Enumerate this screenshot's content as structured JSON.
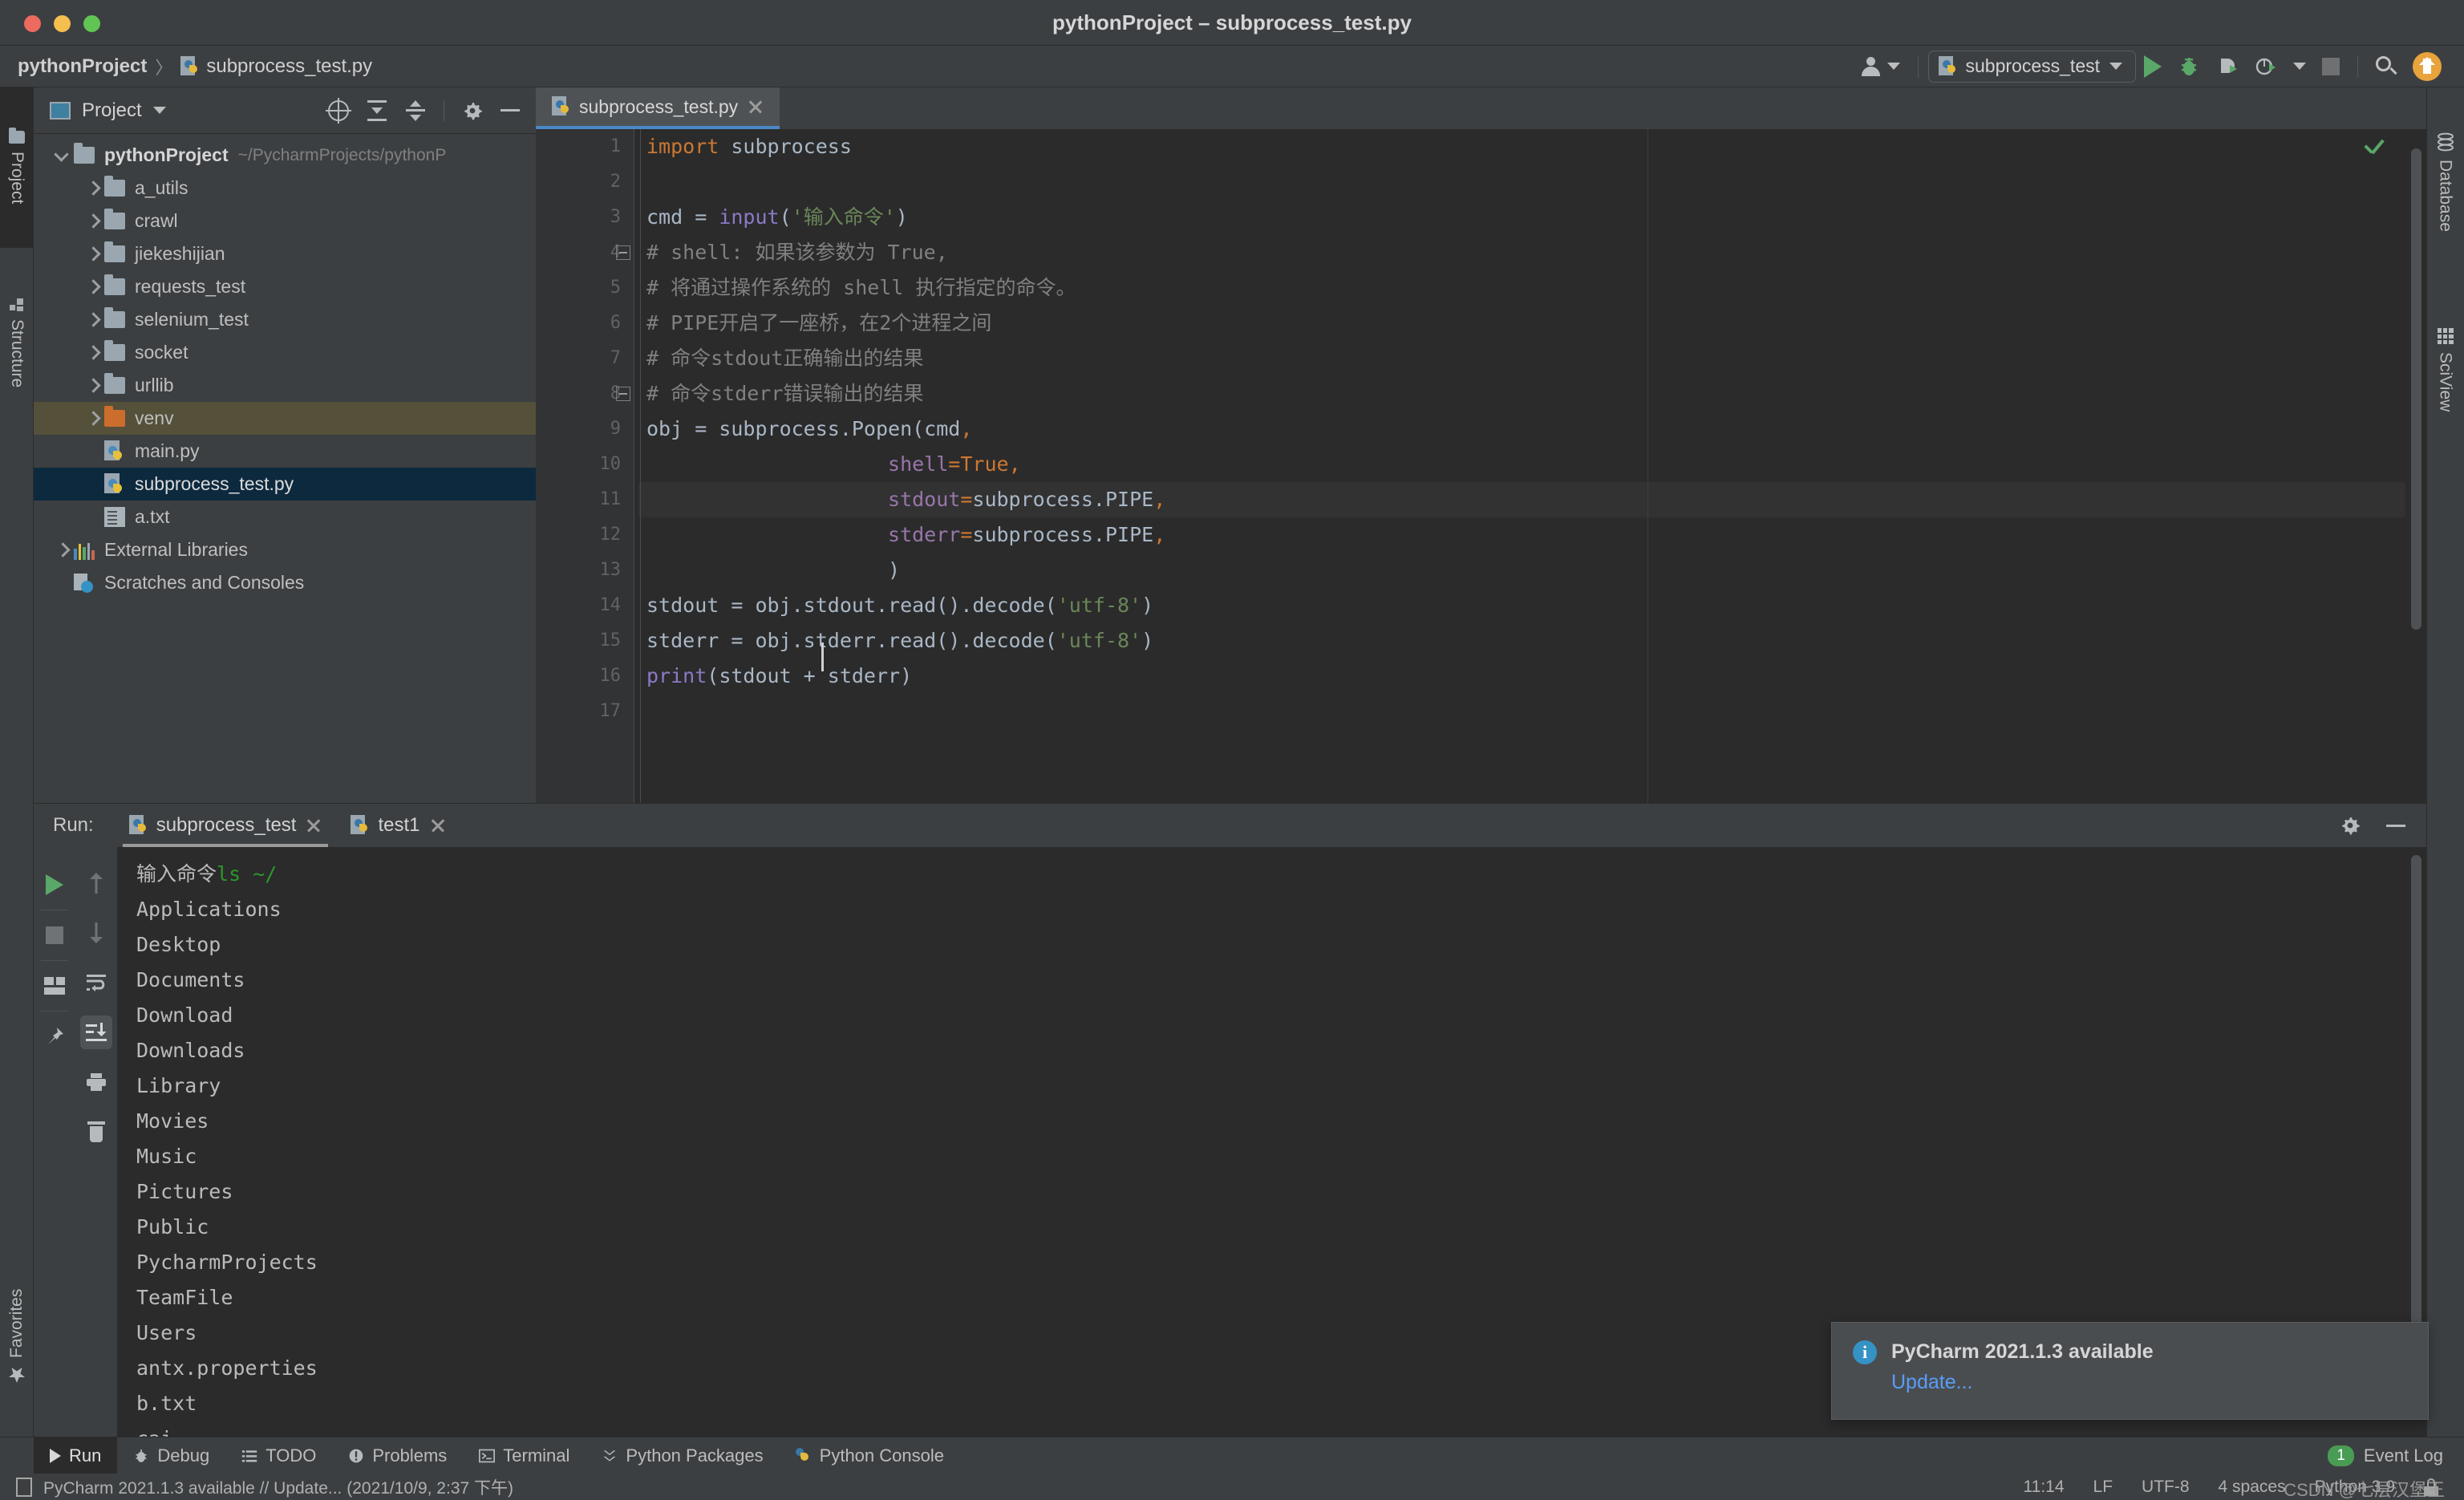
{
  "window": {
    "title": "pythonProject – subprocess_test.py",
    "traffic_lights": [
      "close-red",
      "minimize-yellow",
      "maximize-green"
    ]
  },
  "navbar": {
    "breadcrumb": {
      "project": "pythonProject",
      "separator": "〉",
      "file": "subprocess_test.py",
      "file_icon": "python-file-icon"
    },
    "account_icon": "account-icon",
    "run_config": {
      "icon": "python-file-icon",
      "name": "subprocess_test",
      "dropdown_icon": "chevron-down-icon"
    },
    "actions": [
      {
        "name": "run-button",
        "icon": "play-icon"
      },
      {
        "name": "debug-button",
        "icon": "bug-icon"
      },
      {
        "name": "run-coverage-button",
        "icon": "coverage-icon"
      },
      {
        "name": "profile-button",
        "icon": "profiler-icon"
      },
      {
        "name": "profile-dropdown",
        "icon": "chevron-down-icon"
      },
      {
        "name": "stop-button",
        "icon": "stop-icon"
      },
      {
        "name": "search-everywhere-button",
        "icon": "search-icon"
      },
      {
        "name": "update-button",
        "icon": "arrow-up-circle-icon"
      }
    ]
  },
  "left_tool_strip": [
    {
      "label": "Project",
      "icon": "folder-icon",
      "active": true
    },
    {
      "label": "Structure",
      "icon": "structure-icon",
      "active": false
    },
    {
      "label": "Favorites",
      "icon": "star-icon",
      "active": false
    }
  ],
  "right_tool_strip": [
    {
      "label": "Database",
      "icon": "database-icon"
    },
    {
      "label": "SciView",
      "icon": "grid-icon"
    }
  ],
  "project_panel": {
    "title": "Project",
    "title_icon": "project-window-icon",
    "dropdown_icon": "chevron-down-icon",
    "toolbar": [
      {
        "name": "select-opened-file-button",
        "icon": "locate-icon"
      },
      {
        "name": "expand-all-button",
        "icon": "expand-all-icon"
      },
      {
        "name": "collapse-all-button",
        "icon": "collapse-all-icon"
      },
      {
        "name": "settings-button",
        "icon": "gear-icon"
      },
      {
        "name": "hide-button",
        "icon": "minus-icon"
      }
    ],
    "tree": [
      {
        "label": "pythonProject",
        "path": "~/PycharmProjects/pythonP",
        "type": "root",
        "icon": "folder-icon",
        "arrow": "down",
        "indent": 0,
        "state": "normal"
      },
      {
        "label": "a_utils",
        "type": "folder",
        "icon": "folder-icon",
        "arrow": "right",
        "indent": 1,
        "state": "normal"
      },
      {
        "label": "crawl",
        "type": "folder",
        "icon": "folder-icon",
        "arrow": "right",
        "indent": 1,
        "state": "normal"
      },
      {
        "label": "jiekeshijian",
        "type": "folder",
        "icon": "folder-icon",
        "arrow": "right",
        "indent": 1,
        "state": "normal"
      },
      {
        "label": "requests_test",
        "type": "folder",
        "icon": "folder-icon",
        "arrow": "right",
        "indent": 1,
        "state": "normal"
      },
      {
        "label": "selenium_test",
        "type": "folder",
        "icon": "folder-icon",
        "arrow": "right",
        "indent": 1,
        "state": "normal"
      },
      {
        "label": "socket",
        "type": "folder",
        "icon": "folder-icon",
        "arrow": "right",
        "indent": 1,
        "state": "normal"
      },
      {
        "label": "urllib",
        "type": "folder",
        "icon": "folder-icon",
        "arrow": "right",
        "indent": 1,
        "state": "normal"
      },
      {
        "label": "venv",
        "type": "folder-excluded",
        "icon": "folder-orange-icon",
        "arrow": "right",
        "indent": 1,
        "state": "highlight"
      },
      {
        "label": "main.py",
        "type": "python",
        "icon": "python-file-icon",
        "arrow": "none",
        "indent": 1,
        "state": "normal"
      },
      {
        "label": "subprocess_test.py",
        "type": "python",
        "icon": "python-file-icon",
        "arrow": "none",
        "indent": 1,
        "state": "selected"
      },
      {
        "label": "a.txt",
        "type": "text",
        "icon": "text-file-icon",
        "arrow": "none",
        "indent": 1,
        "state": "normal"
      },
      {
        "label": "External Libraries",
        "type": "libraries",
        "icon": "libraries-icon",
        "arrow": "right",
        "indent": 0,
        "state": "normal"
      },
      {
        "label": "Scratches and Consoles",
        "type": "scratches",
        "icon": "scratches-icon",
        "arrow": "none",
        "indent": 0,
        "state": "normal"
      }
    ]
  },
  "editor": {
    "tabs": [
      {
        "label": "subprocess_test.py",
        "icon": "python-file-icon",
        "active": true,
        "close_icon": "close-icon"
      }
    ],
    "inspection_status_icon": "checkmark-ok-icon",
    "caret_line": 11,
    "lines": [
      {
        "n": 1,
        "tokens": [
          {
            "t": "import",
            "c": "kw"
          },
          {
            "t": " subprocess",
            "c": "plain"
          }
        ]
      },
      {
        "n": 2,
        "tokens": []
      },
      {
        "n": 3,
        "tokens": [
          {
            "t": "cmd ",
            "c": "plain"
          },
          {
            "t": "= ",
            "c": "plain"
          },
          {
            "t": "input",
            "c": "fn"
          },
          {
            "t": "(",
            "c": "plain"
          },
          {
            "t": "'输入命令'",
            "c": "str"
          },
          {
            "t": ")",
            "c": "plain"
          }
        ]
      },
      {
        "n": 4,
        "fold": true,
        "tokens": [
          {
            "t": "# shell: 如果该参数为 True,",
            "c": "cmt"
          }
        ]
      },
      {
        "n": 5,
        "tokens": [
          {
            "t": "# 将通过操作系统的 shell 执行指定的命令。",
            "c": "cmt"
          }
        ]
      },
      {
        "n": 6,
        "tokens": [
          {
            "t": "# PIPE开启了一座桥，在2个进程之间",
            "c": "cmt"
          }
        ]
      },
      {
        "n": 7,
        "tokens": [
          {
            "t": "# 命令stdout正确输出的结果",
            "c": "cmt"
          }
        ]
      },
      {
        "n": 8,
        "fold": true,
        "tokens": [
          {
            "t": "# 命令stderr错误输出的结果",
            "c": "cmt"
          }
        ]
      },
      {
        "n": 9,
        "tokens": [
          {
            "t": "obj ",
            "c": "plain"
          },
          {
            "t": "= subprocess.Popen(cmd",
            "c": "plain"
          },
          {
            "t": ",",
            "c": "kw"
          }
        ]
      },
      {
        "n": 10,
        "tokens": [
          {
            "t": "                    ",
            "c": "plain"
          },
          {
            "t": "shell",
            "c": "par"
          },
          {
            "t": "=",
            "c": "kw"
          },
          {
            "t": "True",
            "c": "kw"
          },
          {
            "t": ",",
            "c": "kw"
          }
        ]
      },
      {
        "n": 11,
        "tokens": [
          {
            "t": "                    ",
            "c": "plain"
          },
          {
            "t": "stdout",
            "c": "par"
          },
          {
            "t": "=",
            "c": "kw"
          },
          {
            "t": "subprocess.PIPE",
            "c": "plain"
          },
          {
            "t": ",",
            "c": "kw"
          }
        ]
      },
      {
        "n": 12,
        "tokens": [
          {
            "t": "                    ",
            "c": "plain"
          },
          {
            "t": "stderr",
            "c": "par"
          },
          {
            "t": "=",
            "c": "kw"
          },
          {
            "t": "subprocess.PIPE",
            "c": "plain"
          },
          {
            "t": ",",
            "c": "kw"
          }
        ]
      },
      {
        "n": 13,
        "tokens": [
          {
            "t": "                    )",
            "c": "plain"
          }
        ]
      },
      {
        "n": 14,
        "tokens": [
          {
            "t": "stdout = obj.stdout.read().decode(",
            "c": "plain"
          },
          {
            "t": "'utf-8'",
            "c": "str"
          },
          {
            "t": ")",
            "c": "plain"
          }
        ]
      },
      {
        "n": 15,
        "tokens": [
          {
            "t": "stderr = obj.stderr.read().decode(",
            "c": "plain"
          },
          {
            "t": "'utf-8'",
            "c": "str"
          },
          {
            "t": ")",
            "c": "plain"
          }
        ]
      },
      {
        "n": 16,
        "tokens": [
          {
            "t": "print",
            "c": "fn"
          },
          {
            "t": "(stdout + stderr)",
            "c": "plain"
          }
        ]
      },
      {
        "n": 17,
        "tokens": []
      }
    ]
  },
  "run_panel": {
    "label": "Run:",
    "tabs": [
      {
        "label": "subprocess_test",
        "icon": "python-file-icon",
        "active": true,
        "close_icon": "close-icon"
      },
      {
        "label": "test1",
        "icon": "python-file-icon",
        "active": false,
        "close_icon": "close-icon"
      }
    ],
    "header_actions": [
      {
        "name": "settings-button",
        "icon": "gear-icon"
      },
      {
        "name": "hide-button",
        "icon": "minus-icon"
      }
    ],
    "side_toolbar_left": [
      {
        "name": "rerun-button",
        "icon": "play-icon"
      },
      {
        "name": "stop-button",
        "icon": "stop-icon"
      },
      {
        "name": "layout-button",
        "icon": "layout-icon"
      },
      {
        "name": "pin-tab-button",
        "icon": "pin-icon"
      }
    ],
    "side_toolbar_right": [
      {
        "name": "up-button",
        "icon": "arrow-up-icon"
      },
      {
        "name": "down-button",
        "icon": "arrow-down-icon"
      },
      {
        "name": "soft-wrap-button",
        "icon": "wrap-icon"
      },
      {
        "name": "scroll-to-end-button",
        "icon": "scroll-end-icon",
        "active": true
      },
      {
        "name": "print-button",
        "icon": "printer-icon"
      },
      {
        "name": "clear-all-button",
        "icon": "trash-icon"
      }
    ],
    "console": {
      "prompt_text": "输入命令",
      "prompt_input": "ls ~/",
      "output": [
        "Applications",
        "Desktop",
        "Documents",
        "Download",
        "Downloads",
        "Library",
        "Movies",
        "Music",
        "Pictures",
        "Public",
        "PycharmProjects",
        "TeamFile",
        "Users",
        "antx.properties",
        "b.txt",
        "cai"
      ]
    }
  },
  "notification": {
    "icon": "info-icon",
    "title": "PyCharm 2021.1.3 available",
    "link": "Update..."
  },
  "bottom_bar": {
    "items": [
      {
        "label": "Run",
        "icon": "play-icon",
        "active": true
      },
      {
        "label": "Debug",
        "icon": "bug-icon",
        "active": false
      },
      {
        "label": "TODO",
        "icon": "list-icon",
        "active": false
      },
      {
        "label": "Problems",
        "icon": "problems-icon",
        "active": false
      },
      {
        "label": "Terminal",
        "icon": "terminal-icon",
        "active": false
      },
      {
        "label": "Python Packages",
        "icon": "packages-icon",
        "active": false
      },
      {
        "label": "Python Console",
        "icon": "python-icon",
        "active": false
      }
    ],
    "event_log": {
      "label": "Event Log",
      "count": "1"
    }
  },
  "status_bar": {
    "message_icon": "message-icon",
    "message": "PyCharm 2021.1.3 available // Update... (2021/10/9, 2:37 下午)",
    "right": [
      {
        "name": "caret-position",
        "label": "11:14"
      },
      {
        "name": "line-separator",
        "label": "LF"
      },
      {
        "name": "file-encoding",
        "label": "UTF-8"
      },
      {
        "name": "indent-size",
        "label": "4 spaces"
      },
      {
        "name": "python-interpreter",
        "label": "Python 3.9"
      },
      {
        "name": "lock-icon",
        "label": ""
      }
    ],
    "watermark": "CSDN @七层汉堡王"
  },
  "colors": {
    "bg_chrome": "#3c3f41",
    "bg_editor": "#2b2b2b",
    "accent_blue": "#4a88c7",
    "selection_blue": "#0d293e",
    "highlight_olive": "#54503a",
    "green_run": "#59a869",
    "orange_keyword": "#cc7832",
    "string_green": "#6a8759",
    "link_blue": "#589df6",
    "badge_green": "#499c54",
    "update_orange": "#e8a33d"
  }
}
